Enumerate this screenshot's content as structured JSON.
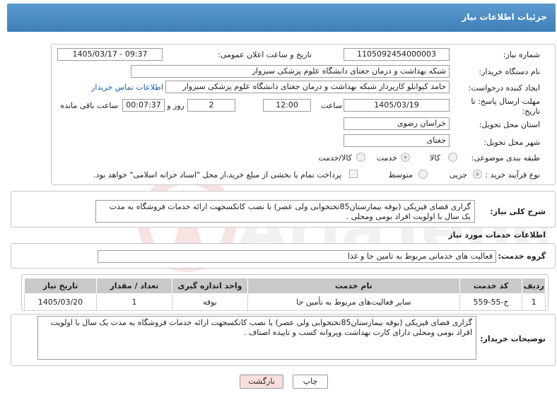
{
  "header": {
    "title": "جزئیات اطلاعات نیاز"
  },
  "form": {
    "need_number_label": "شماره نیاز:",
    "need_number": "1105092454000003",
    "announce_label": "تاریخ و ساعت اعلان عمومی:",
    "announce_value": "1405/03/17 - 09:37",
    "buyer_org_label": "نام دستگاه خریدار:",
    "buyer_org": "شبکه بهداشت و درمان جغتای   دانشگاه علوم پزشکی سبزوار",
    "creator_label": "ایجاد کننده درخواست:",
    "creator": "حامد کیوانلو کارپرداز شبکه بهداشت و درمان جغتای   دانشگاه علوم پزشکی سبزوار",
    "contact_link": "اطلاعات تماس خریدار",
    "deadline_label_1": "مهلت ارسال پاسخ: تا",
    "deadline_label_2": "تاریخ:",
    "deadline_date": "1405/03/19",
    "time_label": "ساعت",
    "deadline_time": "12:00",
    "days_value": "2",
    "days_label": "روز و",
    "remaining_value": "00:07:37",
    "remaining_label": "ساعت باقی مانده",
    "province_label": "استان محل تحویل:",
    "province": "خراسان رضوی",
    "city_label": "شهر محل تحویل:",
    "city": "جغتای",
    "category_label": "طبقه بندی موضوعی:",
    "category_options": [
      "کالا",
      "خدمت",
      "کالا/خدمت"
    ],
    "category_selected": "خدمت",
    "process_label": "نوع فرآیند خرید :",
    "process_options": [
      "جزیی",
      "متوسط"
    ],
    "process_selected": "جزیی",
    "payment_note": "پرداخت تمام یا بخشی از مبلغ خرید،از محل \"اسناد خزانه اسلامی\" خواهد بود."
  },
  "summary": {
    "label": "شرح کلی نیاز:",
    "text": "گزاری فضای  فیزیکی (بوفه بیمارستان85تختخوابی  ولی عصر) با نصب کانکسجهت ارائه خدمات فروشگاه به مدت یک سال  با اولویت افراد بومی ومحلی ."
  },
  "services": {
    "section_title": "اطلاعات خدمات مورد نیاز",
    "group_label": "گروه خدمت:",
    "group_value": "فعالیت های خدماتی مربوط به تامین جا و غذا",
    "columns": [
      "ردیف",
      "کد خدمت",
      "نام خدمت",
      "واحد اندازه گیری",
      "تعداد / مقدار",
      "تاریخ نیاز"
    ],
    "rows": [
      [
        "1",
        "خ-55-559",
        "سایر فعالیت‌های مربوط به تأمین جا",
        "بوفه",
        "1",
        "1405/03/20"
      ]
    ]
  },
  "buyer_notes": {
    "label": "توضیحات خریدار:",
    "text": "گزاری فضای  فیزیکی (بوفه بیمارستان85تختخوابی  ولی عصر) با نصب کانکسجهت ارائه خدمات فروشگاه به مدت یک سال  با اولویت افراد بومی ومحلی دارای کارت بهداشت وپروانه کسب و تاییده اصناف ."
  },
  "buttons": {
    "print": "چاپ",
    "back": "بازگشت"
  },
  "watermark": {
    "text": "AriaTender.neT"
  },
  "colors": {
    "header": "#4a8ac4",
    "link": "#1a5fb4",
    "print_bg": "#ffffff",
    "back_bg": "#f9dede"
  }
}
